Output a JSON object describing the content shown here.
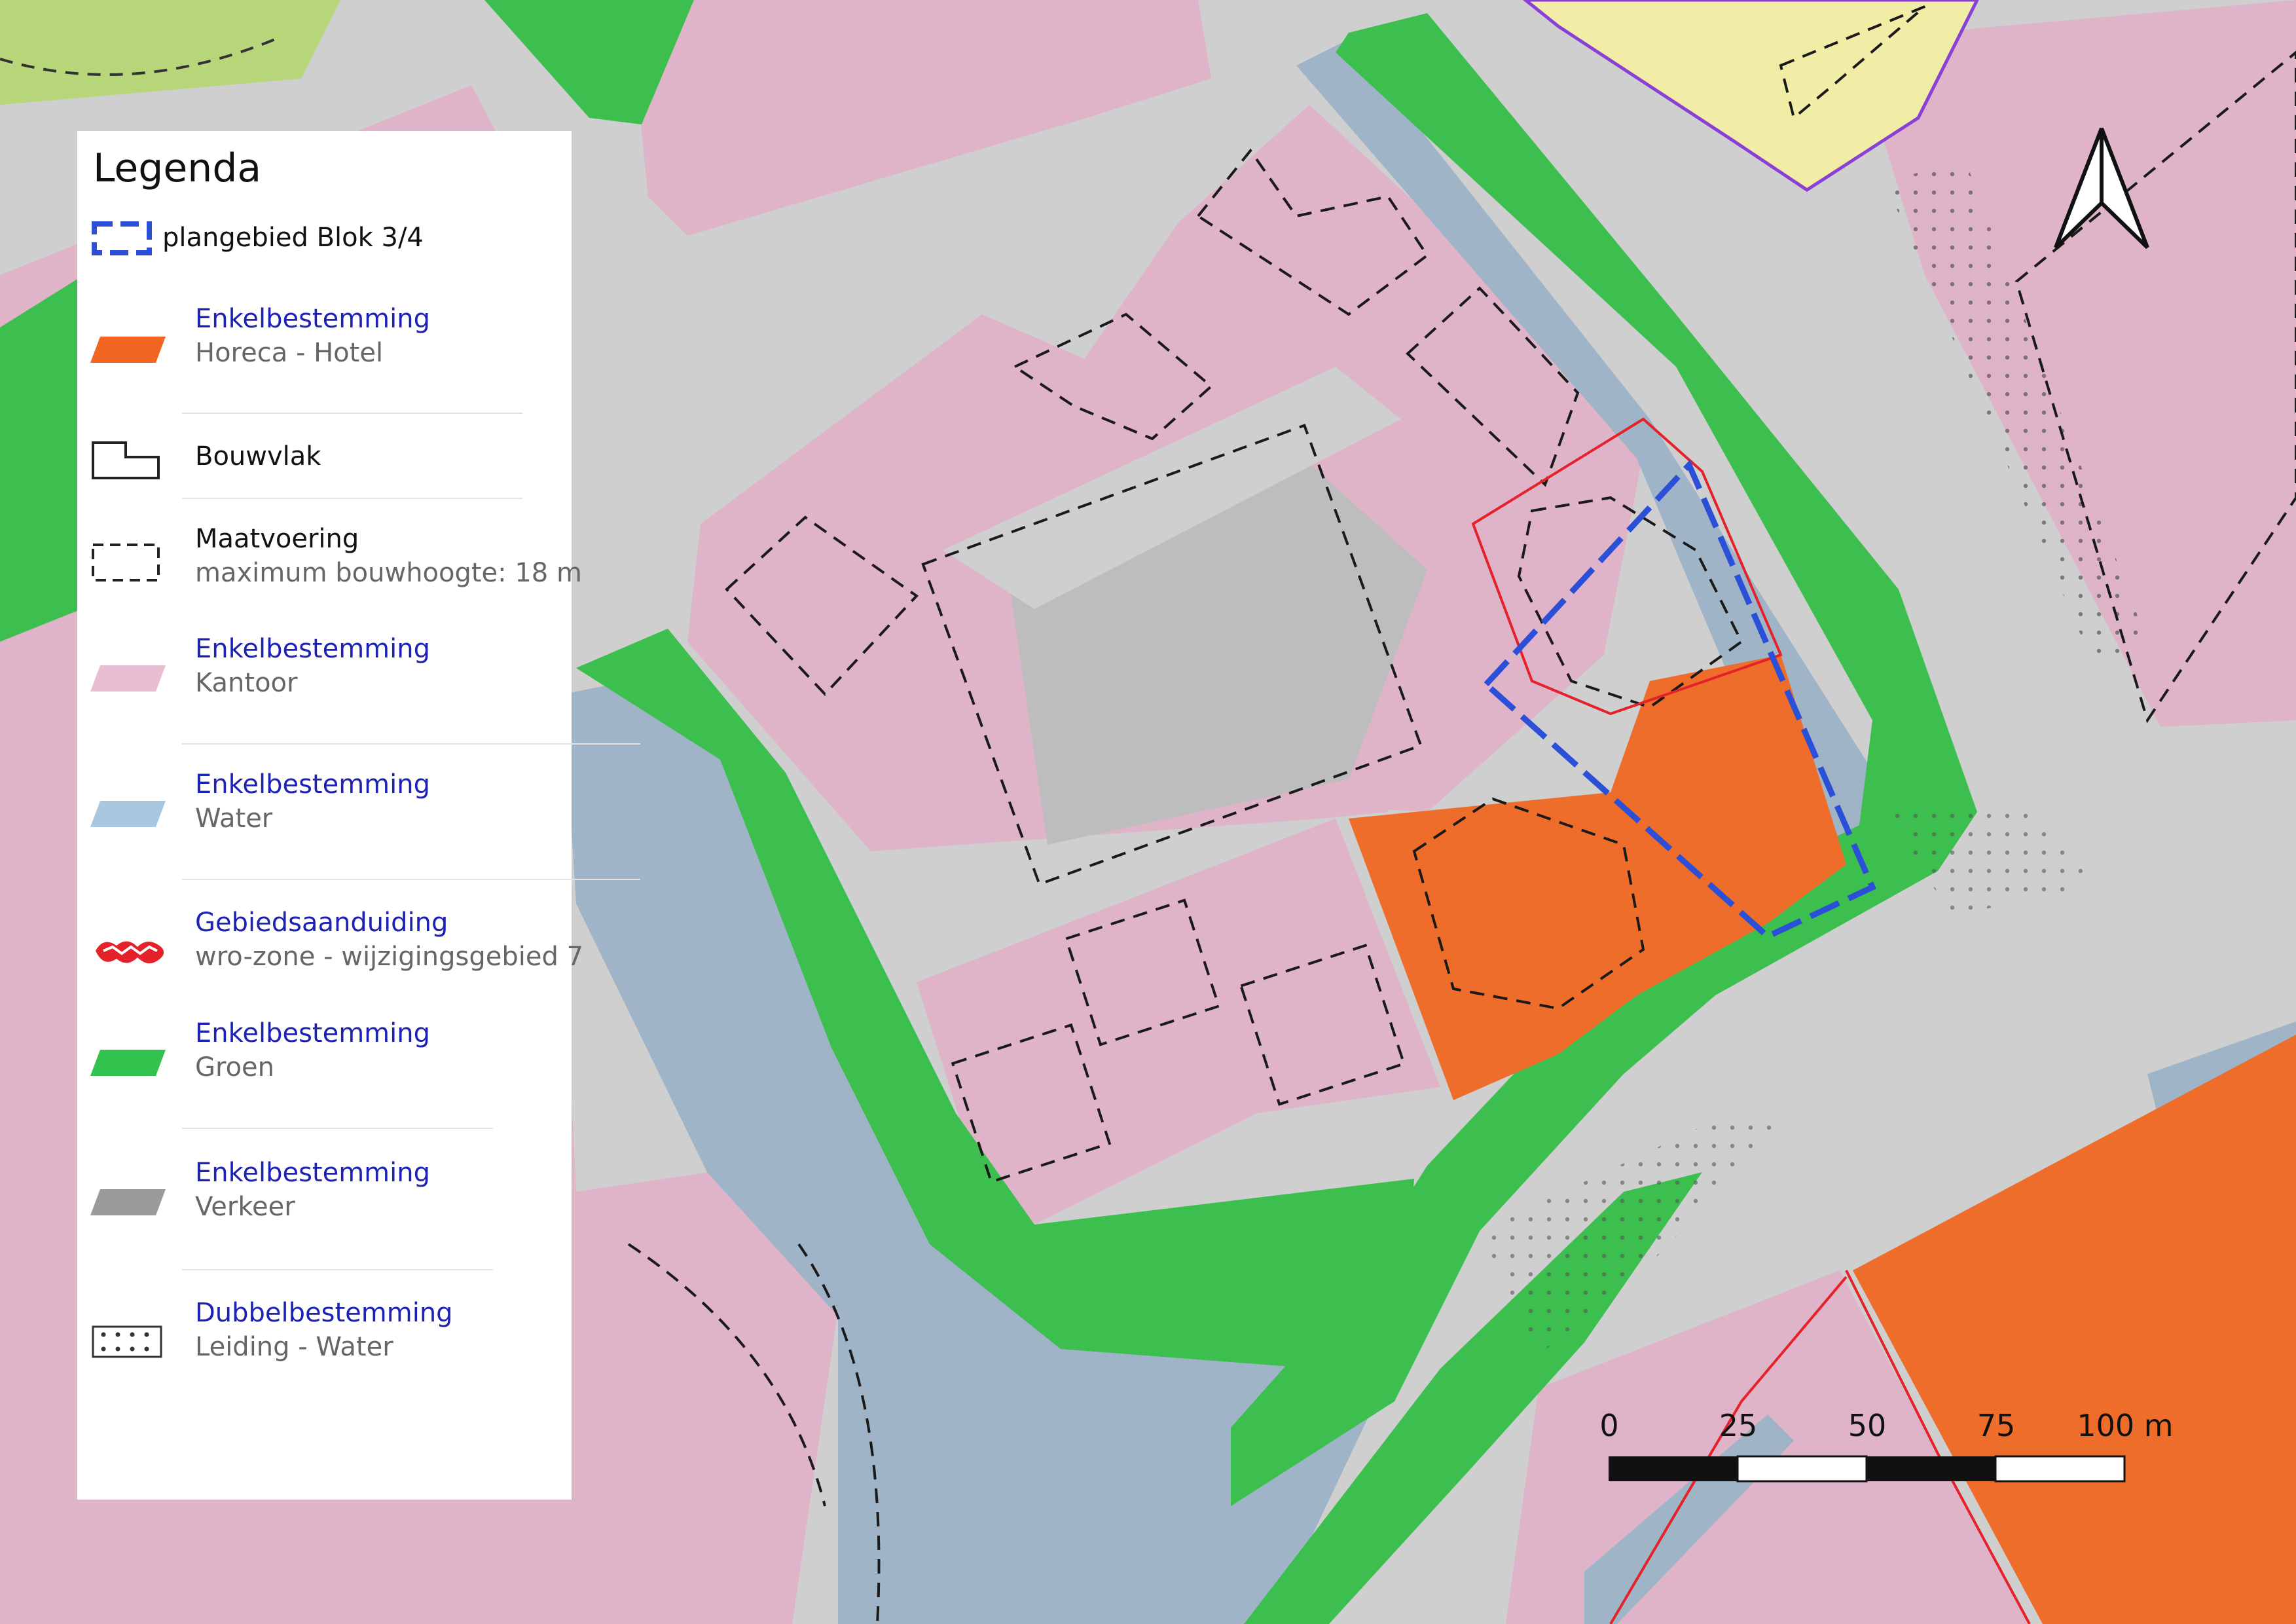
{
  "legend": {
    "title": "Legenda",
    "items": [
      {
        "type": "plan-boundary",
        "label": "plangebied Blok 3/4",
        "color": "#2b4fd6"
      },
      {
        "type": "hotel",
        "category": "Enkelbestemming",
        "label": "Horeca - Hotel",
        "color": "#f26522"
      },
      {
        "type": "bouwvlak",
        "label": "Bouwvlak"
      },
      {
        "type": "maatvoering",
        "category": "Maatvoering",
        "label": "maximum bouwhoogte: 18 m"
      },
      {
        "type": "kantoor",
        "category": "Enkelbestemming",
        "label": "Kantoor",
        "color": "#e8bfd2"
      },
      {
        "type": "water",
        "category": "Enkelbestemming",
        "label": "Water",
        "color": "#a9c8df"
      },
      {
        "type": "gebiedsaanduiding",
        "category": "Gebiedsaanduiding",
        "label": "wro-zone - wijzigingsgebied 7",
        "color": "#e5212a"
      },
      {
        "type": "groen",
        "category": "Enkelbestemming",
        "label": "Groen",
        "color": "#33c24d"
      },
      {
        "type": "verkeer",
        "category": "Enkelbestemming",
        "label": "Verkeer",
        "color": "#9b9b9b"
      },
      {
        "type": "leiding",
        "category": "Dubbelbestemming",
        "label": "Leiding - Water"
      }
    ]
  },
  "scale": {
    "labels": [
      "0",
      "25",
      "50",
      "75",
      "100 m"
    ],
    "unit": "m"
  },
  "north_arrow": {
    "icon": "north-arrow-icon"
  },
  "colors": {
    "kantoor": "#e3b4c8",
    "groen": "#3cbf4f",
    "water": "#a3b9cb",
    "verkeer": "#c9c9c9",
    "hotel": "#ee6d2b",
    "plan_boundary": "#2b4fd6",
    "wro_zone": "#e5212a",
    "yellow_zone": "#f2efa0"
  }
}
